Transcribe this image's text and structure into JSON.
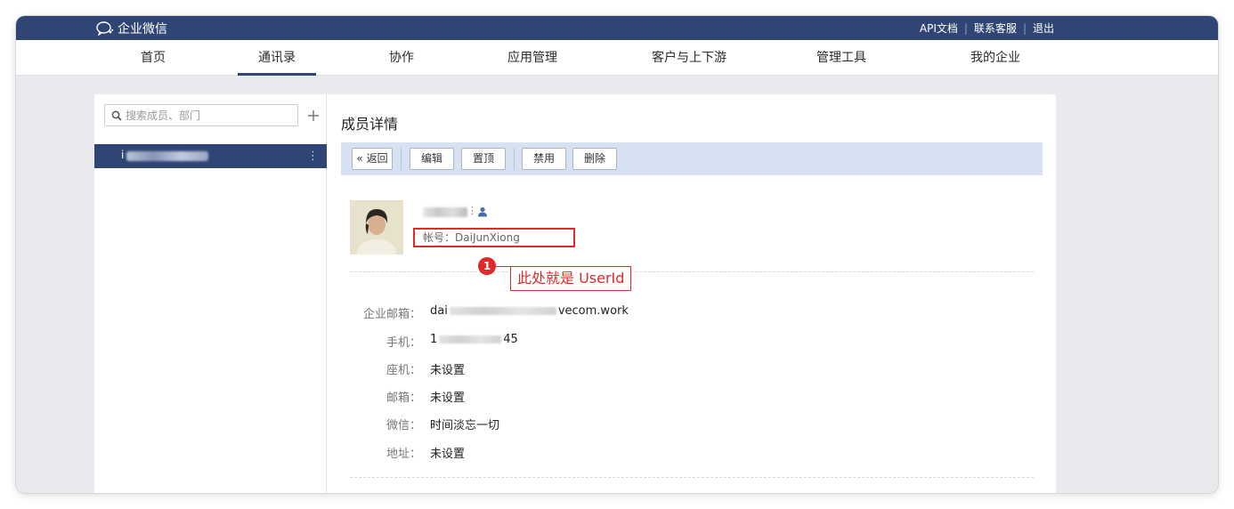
{
  "app": {
    "title": "企业微信"
  },
  "top_links": [
    "API文档",
    "联系客服",
    "退出"
  ],
  "nav": {
    "items": [
      "首页",
      "通讯录",
      "协作",
      "应用管理",
      "客户与上下游",
      "管理工具",
      "我的企业"
    ],
    "active": "通讯录"
  },
  "sidebar": {
    "search_placeholder": "搜索成员、部门",
    "add_label": "+",
    "selected_member_initial": "i",
    "more_label": "⋮"
  },
  "detail": {
    "title": "成员详情",
    "toolbar": {
      "back": "« 返回",
      "edit": "编辑",
      "pin": "置顶",
      "disable": "禁用",
      "delete": "删除"
    },
    "account_label": "帐号：",
    "account_value": "DaiJunXiong",
    "annotation": {
      "number": "1",
      "text": "此处就是 UserId"
    },
    "fields": [
      {
        "label": "企业邮箱：",
        "prefix": "dai",
        "suffix": "vecom.work"
      },
      {
        "label": "手机：",
        "prefix": "1",
        "suffix": "45"
      },
      {
        "label": "座机：",
        "value": "未设置"
      },
      {
        "label": "邮箱：",
        "value": "未设置"
      },
      {
        "label": "微信：",
        "value": "时间淡忘一切"
      },
      {
        "label": "地址：",
        "value": "未设置"
      }
    ]
  },
  "colors": {
    "brand": "#2f4674",
    "toolbar_bg": "#d6e1f1",
    "annotation": "#e02a2a"
  }
}
